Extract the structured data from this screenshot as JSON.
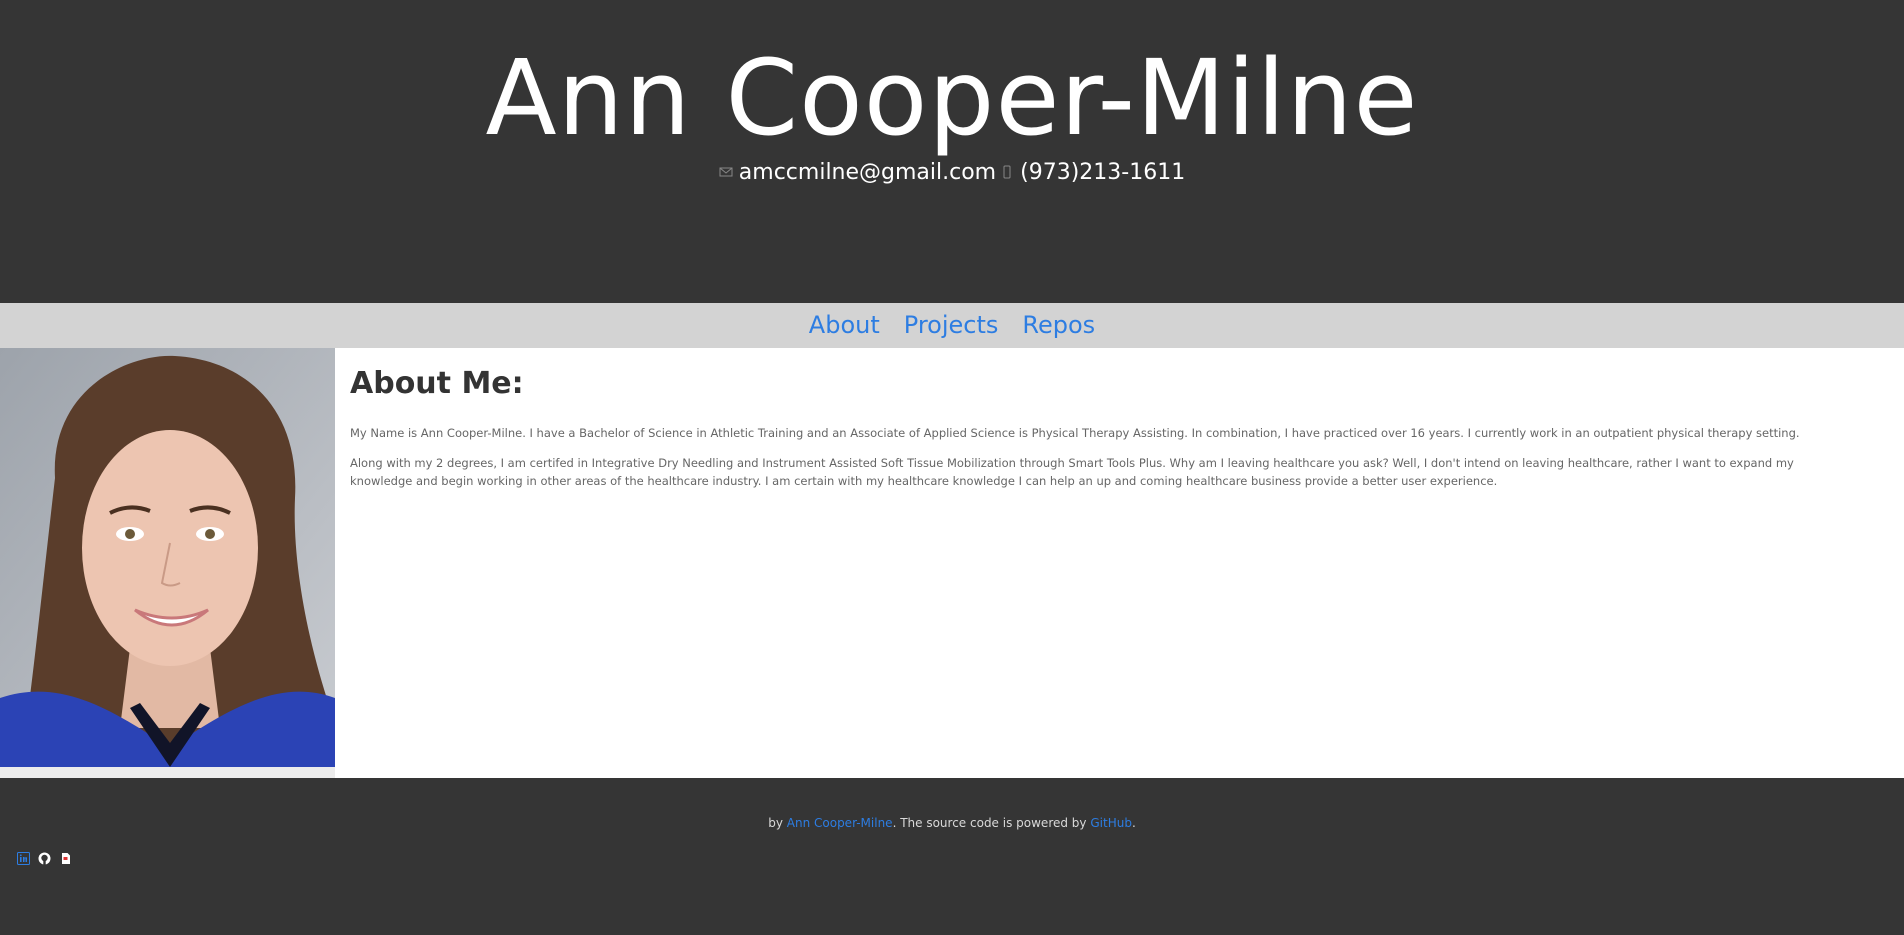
{
  "header": {
    "title": "Ann Cooper-Milne",
    "email": "amccmilne@gmail.com",
    "phone": "(973)213-1611"
  },
  "nav": {
    "items": [
      "About",
      "Projects",
      "Repos"
    ]
  },
  "about": {
    "heading": "About Me:",
    "paragraph1": "My Name is Ann Cooper-Milne. I have a Bachelor of Science in Athletic Training and an Associate of Applied Science is Physical Therapy Assisting. In combination, I have practiced over 16 years. I currently work in an outpatient physical therapy setting.",
    "paragraph2": "Along with my 2 degrees, I am certifed in Integrative Dry Needling and Instrument Assisted Soft Tissue Mobilization through Smart Tools Plus. Why am I leaving healthcare you ask? Well, I don't intend on leaving healthcare, rather I want to expand my knowledge and begin working in other areas of the healthcare industry. I am certain with my healthcare knowledge I can help an up and coming healthcare business provide a better user experience."
  },
  "footer": {
    "by": "by",
    "author_link": "Ann Cooper-Milne",
    "powered_text": ". The source code is powered by",
    "github_link": "GitHub",
    "period": "."
  },
  "social": {
    "icons": [
      "linkedin-icon",
      "github-icon",
      "resume-icon"
    ]
  },
  "colors": {
    "header_bg": "#353535",
    "nav_bg": "#d3d3d3",
    "link": "#2d7de2"
  }
}
